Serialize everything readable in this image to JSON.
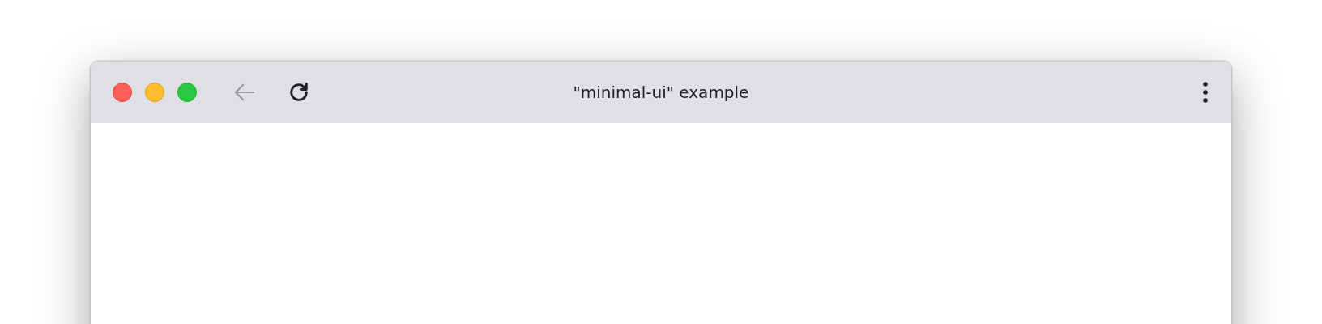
{
  "window": {
    "title": "\"minimal-ui\" example"
  },
  "toolbar": {
    "back": {
      "disabled": true
    },
    "reload": {
      "disabled": false
    }
  }
}
